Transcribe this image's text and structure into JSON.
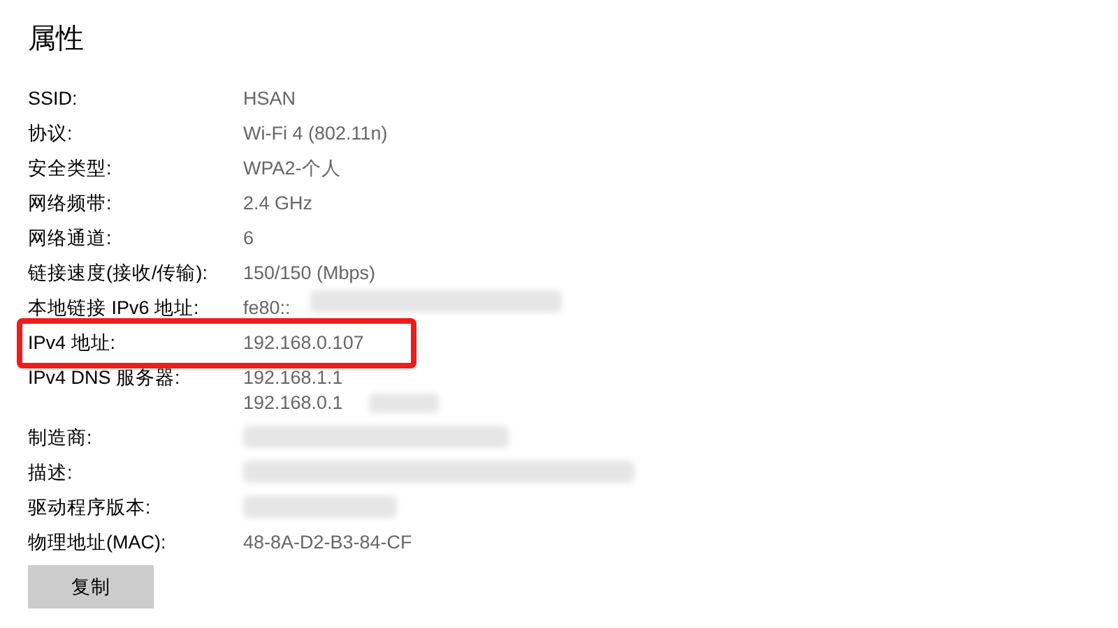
{
  "title": "属性",
  "properties": [
    {
      "label": "SSID:",
      "values": [
        "HSAN"
      ],
      "redacted": false,
      "highlighted": false
    },
    {
      "label": "协议:",
      "values": [
        "Wi-Fi 4 (802.11n)"
      ],
      "redacted": false,
      "highlighted": false
    },
    {
      "label": "安全类型:",
      "values": [
        "WPA2-个人"
      ],
      "redacted": false,
      "highlighted": false
    },
    {
      "label": "网络频带:",
      "values": [
        "2.4 GHz"
      ],
      "redacted": false,
      "highlighted": false
    },
    {
      "label": "网络通道:",
      "values": [
        "6"
      ],
      "redacted": false,
      "highlighted": false
    },
    {
      "label": "链接速度(接收/传输):",
      "values": [
        "150/150 (Mbps)"
      ],
      "redacted": false,
      "highlighted": false
    },
    {
      "label": "本地链接 IPv6 地址:",
      "values": [
        "fe80::"
      ],
      "redacted": true,
      "highlighted": false
    },
    {
      "label": "IPv4 地址:",
      "values": [
        "192.168.0.107"
      ],
      "redacted": false,
      "highlighted": true
    },
    {
      "label": "IPv4 DNS 服务器:",
      "values": [
        "192.168.1.1",
        "192.168.0.1"
      ],
      "redacted": true,
      "highlighted": false
    },
    {
      "label": "制造商:",
      "redacted": true,
      "highlighted": false
    },
    {
      "label": "描述:",
      "redacted": true,
      "highlighted": false
    },
    {
      "label": "驱动程序版本:",
      "redacted": true,
      "highlighted": false
    },
    {
      "label": "物理地址(MAC):",
      "values": [
        "48-8A-D2-B3-84-CF"
      ],
      "redacted": false,
      "highlighted": false
    }
  ],
  "copy_button": "复制"
}
